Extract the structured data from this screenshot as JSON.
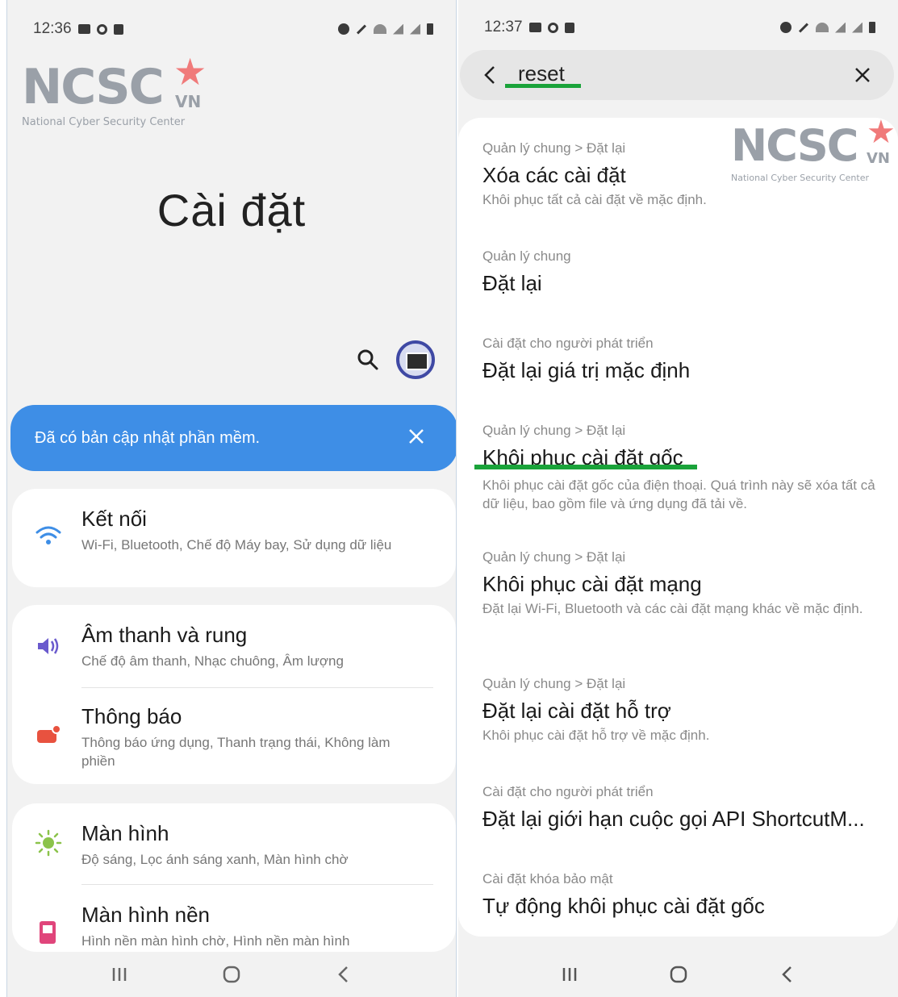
{
  "left_phone": {
    "status": {
      "time": "12:36"
    },
    "logo": {
      "word": "NCSC",
      "country": "VN",
      "subtitle": "National Cyber Security Center"
    },
    "title": "Cài đặt",
    "banner": {
      "text": "Đã có bản cập nhật phần mềm."
    },
    "settings": [
      {
        "title": "Kết nối",
        "subtitle": "Wi-Fi, Bluetooth, Chế độ Máy bay, Sử dụng dữ liệu",
        "icon": "wifi-icon",
        "color": "#3e8ee6"
      },
      {
        "title": "Âm thanh và rung",
        "subtitle": "Chế độ âm thanh, Nhạc chuông, Âm lượng",
        "icon": "volume-icon",
        "color": "#6a5acd"
      },
      {
        "title": "Thông báo",
        "subtitle": "Thông báo ứng dụng, Thanh trạng thái, Không làm phiền",
        "icon": "notification-icon",
        "color": "#e8523f"
      },
      {
        "title": "Màn hình",
        "subtitle": "Độ sáng, Lọc ánh sáng xanh, Màn hình chờ",
        "icon": "brightness-icon",
        "color": "#8bc34a"
      },
      {
        "title": "Màn hình nền",
        "subtitle": "Hình nền màn hình chờ, Hình nền màn hình",
        "icon": "wallpaper-icon",
        "color": "#e0457b"
      }
    ]
  },
  "right_phone": {
    "status": {
      "time": "12:37"
    },
    "logo": {
      "word": "NCSC",
      "country": "VN",
      "subtitle": "National Cyber Security Center"
    },
    "search": {
      "query": "reset"
    },
    "results": [
      {
        "path": "Quản lý chung > Đặt lại",
        "title": "Xóa các cài đặt",
        "desc": "Khôi phục tất cả cài đặt về mặc định."
      },
      {
        "path": "Quản lý chung",
        "title": "Đặt lại",
        "desc": ""
      },
      {
        "path": "Cài đặt cho người phát triển",
        "title": "Đặt lại giá trị mặc định",
        "desc": ""
      },
      {
        "path": "Quản lý chung > Đặt lại",
        "title": "Khôi phục cài đặt gốc",
        "desc": "Khôi phục cài đặt gốc của điện thoại. Quá trình này sẽ xóa tất cả dữ liệu, bao gồm file và ứng dụng đã tải về."
      },
      {
        "path": "Quản lý chung > Đặt lại",
        "title": "Khôi phục cài đặt mạng",
        "desc": "Đặt lại Wi-Fi, Bluetooth và các cài đặt mạng khác về mặc định."
      },
      {
        "path": "Quản lý chung > Đặt lại",
        "title": "Đặt lại cài đặt hỗ trợ",
        "desc": "Khôi phục cài đặt hỗ trợ về mặc định."
      },
      {
        "path": "Cài đặt cho người phát triển",
        "title": "Đặt lại giới hạn cuộc gọi API ShortcutM...",
        "desc": ""
      },
      {
        "path": "Cài đặt khóa bảo mật",
        "title": "Tự động khôi phục cài đặt gốc",
        "desc": ""
      }
    ]
  },
  "colors": {
    "accent_blue": "#3e8ee6",
    "highlight_green": "#1aa33a",
    "logo_red": "#f07a7a"
  }
}
